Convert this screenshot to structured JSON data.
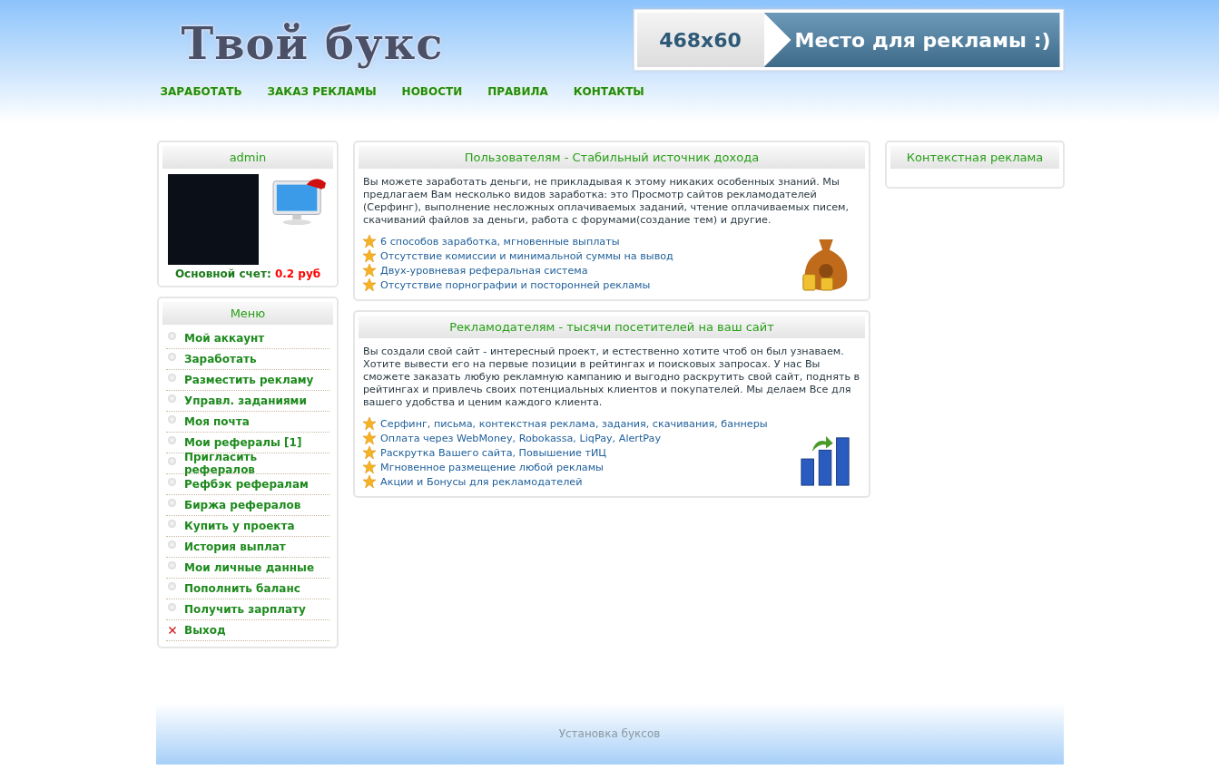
{
  "header": {
    "logo": "Твой букс",
    "banner": {
      "size": "468x60",
      "text": "Место для рекламы :)"
    },
    "nav": [
      "ЗАРАБОТАТЬ",
      "ЗАКАЗ РЕКЛАМЫ",
      "НОВОСТИ",
      "ПРАВИЛА",
      "КОНТАКТЫ"
    ]
  },
  "user_panel": {
    "title": "admin",
    "balance_label": "Основной счет:",
    "balance_value": "0.2 руб"
  },
  "menu": {
    "title": "Меню",
    "items": [
      {
        "label": "Мой аккаунт",
        "kind": "bullet"
      },
      {
        "label": "Заработать",
        "kind": "bullet"
      },
      {
        "label": "Разместить рекламу",
        "kind": "bullet"
      },
      {
        "label": "Управл. заданиями",
        "kind": "bullet"
      },
      {
        "label": "Моя почта",
        "kind": "bullet"
      },
      {
        "label": "Мои рефералы [1]",
        "kind": "bullet"
      },
      {
        "label": "Пригласить рефералов",
        "kind": "bullet"
      },
      {
        "label": "Рефбэк рефералам",
        "kind": "bullet"
      },
      {
        "label": "Биржа рефералов",
        "kind": "bullet"
      },
      {
        "label": "Купить у проекта",
        "kind": "bullet"
      },
      {
        "label": "История выплат",
        "kind": "bullet"
      },
      {
        "label": "Мои личные данные",
        "kind": "bullet"
      },
      {
        "label": "Пополнить баланс",
        "kind": "bullet"
      },
      {
        "label": "Получить зарплату",
        "kind": "bullet"
      },
      {
        "label": "Выход",
        "kind": "exit"
      }
    ]
  },
  "sections": [
    {
      "title": "Пользователям - Стабильный источник дохода",
      "kind": "money",
      "text": "Вы можете заработать деньги, не прикладывая к этому никаких особенных знаний. Мы предлагаем Вам несколько видов заработка: это Просмотр сайтов рекламодателей (Серфинг), выполнение несложных оплачиваемых заданий, чтение оплачиваемых писем, скачиваний файлов за деньги, работа с форумами(создание тем) и другие.",
      "features": [
        "6 способов заработка, мгновенные выплаты",
        "Отсутствие комиссии и минимальной суммы на вывод",
        "Двух-уровневая реферальная система",
        "Отсутствие порнографии и посторонней рекламы"
      ]
    },
    {
      "title": "Рекламодателям - тысячи посетителей на ваш сайт",
      "kind": "growth",
      "text": "Вы создали свой сайт - интересный проект, и естественно хотите чтоб он был узнаваем. Хотите вывести его на первые позиции в рейтингах и поисковых запросах. У нас Вы сможете заказать любую рекламную кампанию и выгодно раскрутить свой сайт, поднять в рейтингах и привлечь своих потенциальных клиентов и покупателей. Мы делаем Все для вашего удобства и ценим каждого клиента.",
      "features": [
        "Серфинг, письма, контекстная реклама, задания, скачивания, баннеры",
        "Оплата через WebMoney, Robokassa, LiqPay, AlertPay",
        "Раскрутка Вашего сайта, Повышение тИЦ",
        "Мгновенное размещение любой рекламы",
        "Акции и Бонусы для рекламодателей"
      ]
    }
  ],
  "right_panel": {
    "title": "Контекстная реклама"
  },
  "footer": {
    "text": "Установка буксов"
  }
}
